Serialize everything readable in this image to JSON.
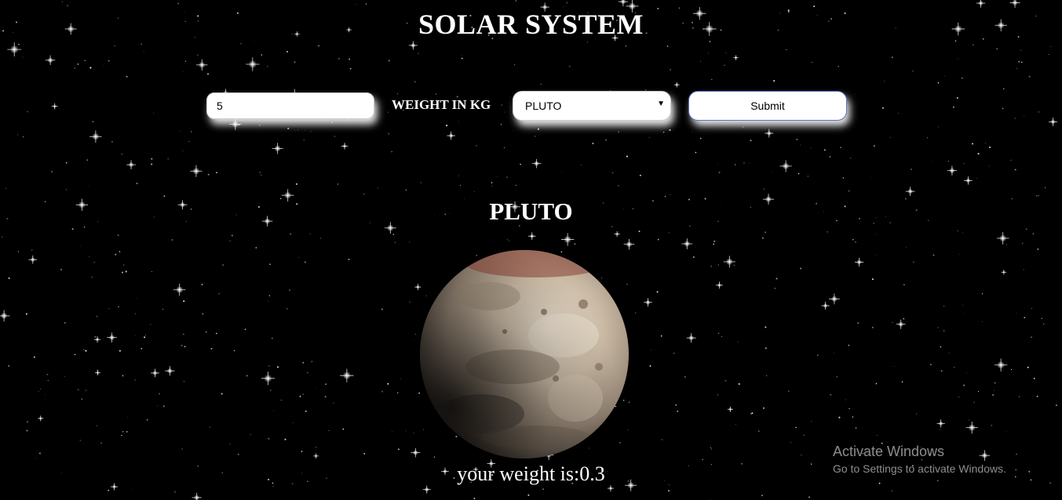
{
  "page": {
    "title": "SOLAR SYSTEM"
  },
  "form": {
    "weight_value": "5",
    "weight_label": "WEIGHT IN KG",
    "planet_selected": "PLUTO",
    "submit_label": "Submit"
  },
  "result": {
    "planet_name": "PLUTO",
    "weight_text": "your weight is:0.3"
  },
  "watermark": {
    "title": "Activate Windows",
    "subtitle": "Go to Settings to activate Windows."
  },
  "colors": {
    "background": "#000000",
    "text": "#ffffff",
    "button_border": "#5b6fc9"
  },
  "icons": {
    "dropdown_arrow": "triangle-down"
  }
}
